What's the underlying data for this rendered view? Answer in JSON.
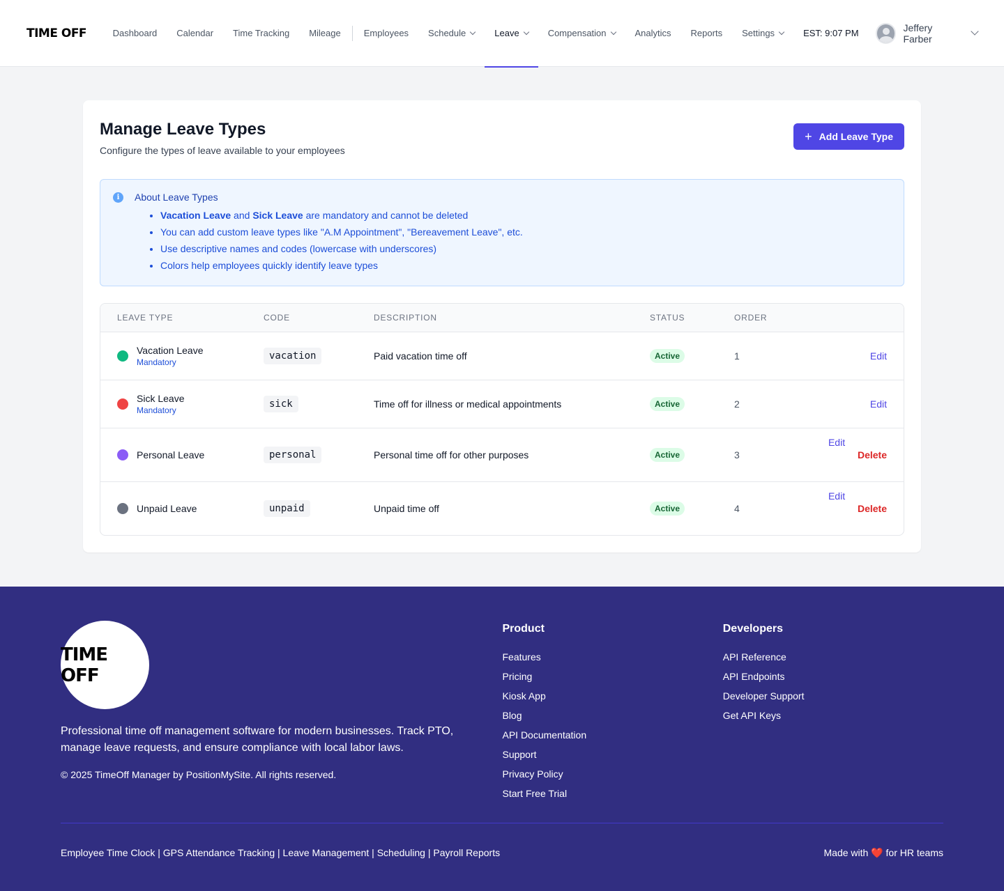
{
  "nav": {
    "logo": "TIME OFF",
    "items": [
      {
        "label": "Dashboard"
      },
      {
        "label": "Calendar"
      },
      {
        "label": "Time Tracking"
      },
      {
        "label": "Mileage"
      },
      {
        "label": "Employees"
      },
      {
        "label": "Schedule"
      },
      {
        "label": "Leave"
      },
      {
        "label": "Compensation"
      },
      {
        "label": "Analytics"
      },
      {
        "label": "Reports"
      },
      {
        "label": "Settings"
      }
    ],
    "clock": "EST: 9:07 PM",
    "user_name": "Jeffery Farber"
  },
  "page": {
    "title": "Manage Leave Types",
    "subtitle": "Configure the types of leave available to your employees",
    "add_button": "Add Leave Type",
    "add_icon": "+"
  },
  "info": {
    "title": "About Leave Types",
    "b1_strong1": "Vacation Leave",
    "b1_and": " and ",
    "b1_strong2": "Sick Leave",
    "b1_rest": " are mandatory and cannot be deleted",
    "b2": "You can add custom leave types like \"A.M Appointment\", \"Bereavement Leave\", etc.",
    "b3": "Use descriptive names and codes (lowercase with underscores)",
    "b4": "Colors help employees quickly identify leave types"
  },
  "table": {
    "headers": {
      "leave_type": "LEAVE TYPE",
      "code": "CODE",
      "description": "DESCRIPTION",
      "status": "STATUS",
      "order": "ORDER"
    },
    "rows": [
      {
        "name": "Vacation Leave",
        "tag": "Mandatory",
        "color": "#10b981",
        "code": "vacation",
        "description": "Paid vacation time off",
        "status": "Active",
        "order": "1",
        "edit": "Edit"
      },
      {
        "name": "Sick Leave",
        "tag": "Mandatory",
        "color": "#ef4444",
        "code": "sick",
        "description": "Time off for illness or medical appointments",
        "status": "Active",
        "order": "2",
        "edit": "Edit"
      },
      {
        "name": "Personal Leave",
        "color": "#8b5cf6",
        "code": "personal",
        "description": "Personal time off for other purposes",
        "status": "Active",
        "order": "3",
        "edit": "Edit",
        "delete": "Delete"
      },
      {
        "name": "Unpaid Leave",
        "color": "#6b7280",
        "code": "unpaid",
        "description": "Unpaid time off",
        "status": "Active",
        "order": "4",
        "edit": "Edit",
        "delete": "Delete"
      }
    ]
  },
  "footer": {
    "logo": "TIME OFF",
    "description": "Professional time off management software for modern businesses. Track PTO, manage leave requests, and ensure compliance with local labor laws.",
    "copyright": "© 2025 TimeOff Manager by PositionMySite. All rights reserved.",
    "product_title": "Product",
    "product_links": [
      "Features",
      "Pricing",
      "Kiosk App",
      "Blog",
      "API Documentation",
      "Support",
      "Privacy Policy",
      "Start Free Trial"
    ],
    "dev_title": "Developers",
    "dev_links": [
      "API Reference",
      "API Endpoints",
      "Developer Support",
      "Get API Keys"
    ],
    "bottom_left": "Employee Time Clock | GPS Attendance Tracking | Leave Management | Scheduling | Payroll Reports",
    "made_with": "Made with",
    "heart": "❤️",
    "for_hr": "for HR teams"
  }
}
